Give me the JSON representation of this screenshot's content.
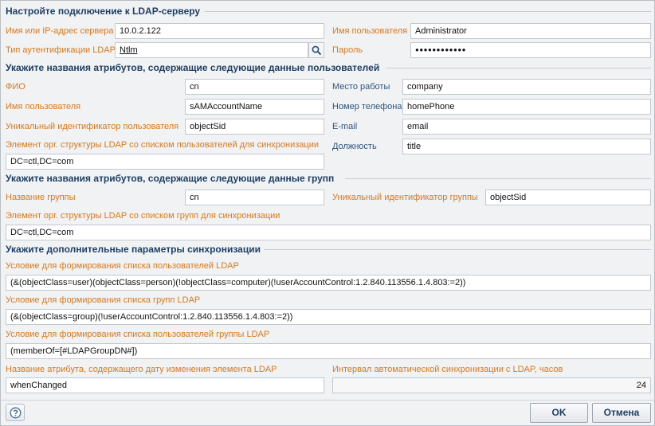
{
  "sections": {
    "connection": "Настройте подключение к LDAP-серверу",
    "user_attrs": "Укажите названия атрибутов, содержащие следующие данные пользователей",
    "group_attrs": "Укажите названия атрибутов, содержащие следующие данные групп",
    "extra": "Укажите дополнительные параметры синхронизации"
  },
  "connection": {
    "server_label": "Имя или IP-адрес сервера",
    "server_value": "10.0.2.122",
    "auth_label": "Тип аутентификации LDAP",
    "auth_value": "Ntlm",
    "username_label": "Имя пользователя",
    "username_value": "Administrator",
    "password_label": "Пароль",
    "password_value": "●●●●●●●●●●●●"
  },
  "user_attrs": {
    "fio_label": "ФИО",
    "fio_value": "cn",
    "username_label": "Имя пользователя",
    "username_value": "sAMAccountName",
    "uid_label": "Уникальный идентификатор пользователя",
    "uid_value": "objectSid",
    "org_label": "Элемент орг. структуры LDAP со списком пользователей для синхронизации",
    "org_value": "DC=ctl,DC=com",
    "work_label": "Место работы",
    "work_value": "company",
    "phone_label": "Номер телефона",
    "phone_value": "homePhone",
    "email_label": "E-mail",
    "email_value": "email",
    "position_label": "Должность",
    "position_value": "title"
  },
  "group_attrs": {
    "name_label": "Название группы",
    "name_value": "cn",
    "uid_label": "Уникальный идентификатор группы",
    "uid_value": "objectSid",
    "org_label": "Элемент орг. структуры LDAP со списком групп для синхронизации",
    "org_value": "DC=ctl,DC=com"
  },
  "extra": {
    "users_cond_label": "Условие для формирования списка пользователей LDAP",
    "users_cond_value": "(&(objectClass=user)(objectClass=person)(!objectClass=computer)(!userAccountControl:1.2.840.113556.1.4.803:=2))",
    "groups_cond_label": "Условие для формирования списка групп LDAP",
    "groups_cond_value": "(&(objectClass=group)(!userAccountControl:1.2.840.113556.1.4.803:=2))",
    "group_users_cond_label": "Условие для формирования списка пользователей группы LDAP",
    "group_users_cond_value": "(memberOf=[#LDAPGroupDN#])",
    "date_attr_label": "Название атрибута, содержащего дату изменения элемента LDAP",
    "date_attr_value": "whenChanged",
    "interval_label": "Интервал автоматической синхронизации с LDAP, часов",
    "interval_value": "24"
  },
  "buttons": {
    "ok": "OK",
    "cancel": "Отмена"
  },
  "icons": {
    "lookup": "magnifier-icon",
    "help": "help-icon"
  },
  "colors": {
    "section_title": "#1d3f63",
    "label_orange": "#d9781a",
    "label_blue": "#2b5580"
  }
}
